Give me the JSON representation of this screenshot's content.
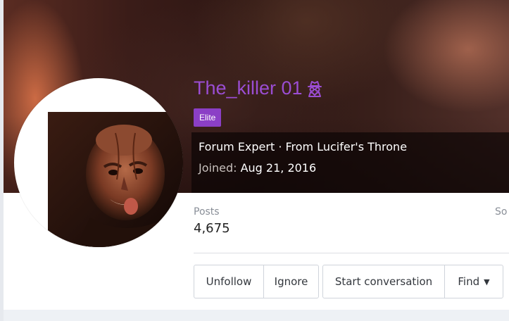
{
  "profile": {
    "username": "The_killer 01",
    "user_icon": "spy-icon",
    "badge": "Elite",
    "tagline": "Forum Expert · From Lucifer's Throne",
    "joined_label": "Joined:",
    "joined_date": "Aug 21, 2016"
  },
  "stats": {
    "posts_label": "Posts",
    "posts_value": "4,675",
    "next_label_partial": "So"
  },
  "actions": {
    "unfollow": "Unfollow",
    "ignore": "Ignore",
    "start_conversation": "Start conversation",
    "find": "Find"
  },
  "colors": {
    "username": "#9b4dd3",
    "badge_bg": "#8b3fc6"
  }
}
